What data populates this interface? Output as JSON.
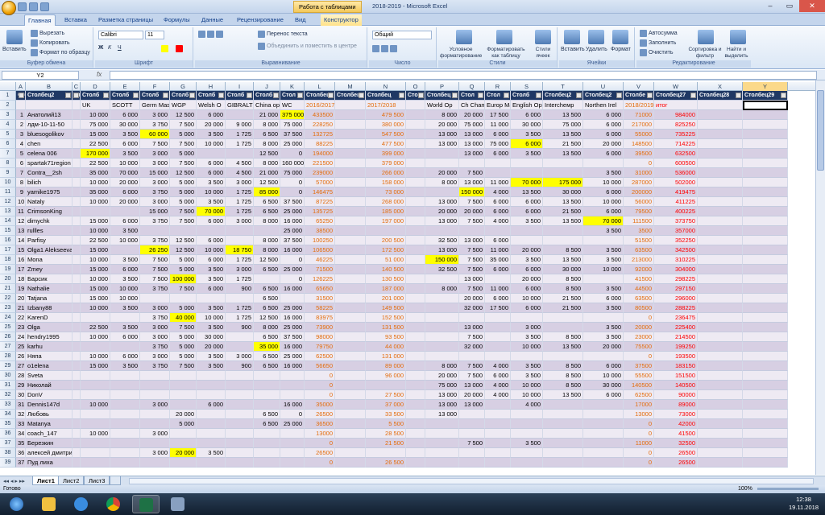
{
  "window": {
    "title": "2018-2019 - Microsoft Excel",
    "context_tab_title": "Работа с таблицами",
    "controls": [
      "–",
      "▭",
      "✕"
    ]
  },
  "ribbon_tabs": [
    "Главная",
    "Вставка",
    "Разметка страницы",
    "Формулы",
    "Данные",
    "Рецензирование",
    "Вид",
    "Конструктор"
  ],
  "ribbon": {
    "clipboard": {
      "group": "Буфер обмена",
      "paste": "Вставить",
      "cut": "Вырезать",
      "copy": "Копировать",
      "format_painter": "Формат по образцу"
    },
    "font": {
      "group": "Шрифт",
      "name": "Calibri",
      "size": "11"
    },
    "alignment": {
      "group": "Выравнивание",
      "wrap": "Перенос текста",
      "merge": "Объединить и поместить в центре"
    },
    "number": {
      "group": "Число",
      "format": "Общий"
    },
    "styles": {
      "group": "Стили",
      "conditional": "Условное форматирование",
      "as_table": "Форматировать как таблицу",
      "cell_styles": "Стили ячеек"
    },
    "cells": {
      "group": "Ячейки",
      "insert": "Вставить",
      "delete": "Удалить",
      "format": "Формат"
    },
    "editing": {
      "group": "Редактирование",
      "autosum": "Автосумма",
      "fill": "Заполнить",
      "clear": "Очистить",
      "sort": "Сортировка и фильтр",
      "find": "Найти и выделить"
    }
  },
  "formula_bar": {
    "name_box": "Y2",
    "fx": "fx",
    "value": ""
  },
  "columns": [
    "A",
    "B",
    "C",
    "D",
    "E",
    "F",
    "G",
    "H",
    "I",
    "J",
    "K",
    "L",
    "M",
    "N",
    "O",
    "P",
    "Q",
    "R",
    "S",
    "T",
    "U",
    "V",
    "W",
    "X",
    "Y"
  ],
  "header_row": [
    "Столб",
    "Столбец2",
    "Сто",
    "Столб",
    "Столб",
    "Столб",
    "Столб",
    "Столб",
    "Столб",
    "Столб",
    "Стол",
    "Столбец",
    "Столбец",
    "Столбец",
    "Сто",
    "Столбец",
    "Стол",
    "Стол",
    "Столб",
    "Столбец2",
    "Столбец2",
    "Столбе",
    "Столбец27",
    "Столбец28",
    "Столбец29"
  ],
  "row2": [
    "",
    "",
    "",
    "UK",
    "SCOTT",
    "Germ Mas",
    "WGP",
    "Welsh O",
    "GIBRALT",
    "China op",
    "WC",
    "2016/2017",
    "",
    "2017/2018",
    "",
    "World Op",
    "Ch Cham",
    "Europ Ma",
    "English Op",
    "Intercheмp",
    "Northen Irel",
    "2018/2019",
    "итог",
    "",
    ""
  ],
  "rows": [
    [
      "1",
      "Анатолий13",
      "",
      "10 000",
      "6 000",
      "3 000",
      "12 500",
      "6 000",
      "",
      "21 000",
      "375 000",
      "433500",
      "",
      "479 500",
      "",
      "8 000",
      "20 000",
      "17 500",
      "6 000",
      "13 500",
      "6 000",
      "71000",
      "984000",
      "",
      ""
    ],
    [
      "2",
      "лдм-10-11-50",
      "",
      "75 000",
      "30 000",
      "3 750",
      "7 500",
      "20 000",
      "9 000",
      "8 000",
      "75 000",
      "228250",
      "",
      "380 000",
      "",
      "20 000",
      "75 000",
      "11 000",
      "30 000",
      "75 000",
      "6 000",
      "217000",
      "825250",
      "",
      ""
    ],
    [
      "3",
      "bluesogolikov",
      "",
      "15 000",
      "3 500",
      "60 000",
      "5 000",
      "3 500",
      "1 725",
      "6 500",
      "37 500",
      "132725",
      "",
      "547 500",
      "",
      "13 000",
      "13 000",
      "6 000",
      "3 500",
      "13 500",
      "6 000",
      "55000",
      "735225",
      "",
      ""
    ],
    [
      "4",
      "chen",
      "",
      "22 500",
      "6 000",
      "7 500",
      "7 500",
      "10 000",
      "1 725",
      "8 000",
      "25 000",
      "88225",
      "",
      "477 500",
      "",
      "13 000",
      "13 000",
      "75 000",
      "6 000",
      "21 500",
      "20 000",
      "148500",
      "714225",
      "",
      ""
    ],
    [
      "5",
      "celena 006",
      "",
      "170 000",
      "3 500",
      "3 000",
      "5 000",
      "",
      "",
      "12 500",
      "0",
      "194000",
      "",
      "399 000",
      "",
      "",
      "13 000",
      "6 000",
      "3 500",
      "13 500",
      "6 000",
      "39500",
      "632500",
      "",
      ""
    ],
    [
      "6",
      "spartak71region",
      "",
      "22 500",
      "10 000",
      "3 000",
      "7 500",
      "6 000",
      "4 500",
      "8 000",
      "160 000",
      "221500",
      "",
      "379 000",
      "",
      "",
      "",
      "",
      "",
      "",
      "",
      "0",
      "600500",
      "",
      ""
    ],
    [
      "7",
      "Contra__2sh",
      "",
      "35 000",
      "70 000",
      "15 000",
      "12 500",
      "6 000",
      "4 500",
      "21 000",
      "75 000",
      "239000",
      "",
      "266 000",
      "",
      "20 000",
      "7 500",
      "",
      "",
      "",
      "3 500",
      "31000",
      "536000",
      "",
      ""
    ],
    [
      "8",
      "bilich",
      "",
      "10 000",
      "20 000",
      "3 000",
      "5 000",
      "3 500",
      "3 000",
      "12 500",
      "0",
      "57000",
      "",
      "158 000",
      "",
      "8 000",
      "13 000",
      "11 000",
      "70 000",
      "175 000",
      "10 000",
      "287000",
      "502000",
      "",
      ""
    ],
    [
      "9",
      "yamike1975",
      "",
      "35 000",
      "6 000",
      "3 750",
      "5 000",
      "10 000",
      "1 725",
      "85 000",
      "0",
      "146475",
      "",
      "73 000",
      "",
      "",
      "150 000",
      "4 000",
      "13 500",
      "30 000",
      "6 000",
      "200000",
      "419475",
      "",
      ""
    ],
    [
      "10",
      "Nataly",
      "",
      "10 000",
      "20 000",
      "3 000",
      "5 000",
      "3 500",
      "1 725",
      "6 500",
      "37 500",
      "87225",
      "",
      "268 000",
      "",
      "13 000",
      "7 500",
      "6 000",
      "6 000",
      "13 500",
      "10 000",
      "56000",
      "411225",
      "",
      ""
    ],
    [
      "11",
      "CrimsonKing",
      "",
      "",
      "",
      "15 000",
      "7 500",
      "70 000",
      "1 725",
      "6 500",
      "25 000",
      "135725",
      "",
      "185 000",
      "",
      "20 000",
      "20 000",
      "6 000",
      "6 000",
      "21 500",
      "6 000",
      "79500",
      "400225",
      "",
      ""
    ],
    [
      "12",
      "dimychk",
      "",
      "15 000",
      "6 000",
      "3 750",
      "7 500",
      "6 000",
      "3 000",
      "8 000",
      "16 000",
      "65250",
      "",
      "197 000",
      "",
      "13 000",
      "7 500",
      "4 000",
      "3 500",
      "13 500",
      "70 000",
      "111500",
      "373750",
      "",
      ""
    ],
    [
      "13",
      "rullles",
      "",
      "10 000",
      "3 500",
      "",
      "",
      "",
      "",
      "",
      "25 000",
      "38500",
      "",
      "",
      "",
      "",
      "",
      "",
      "",
      "",
      "3 500",
      "3500",
      "357000",
      "",
      ""
    ],
    [
      "14",
      "Parfisy",
      "",
      "22 500",
      "10 000",
      "3 750",
      "12 500",
      "6 000",
      "",
      "8 000",
      "37 500",
      "100250",
      "",
      "200 500",
      "",
      "32 500",
      "13 000",
      "6 000",
      "",
      "",
      "",
      "51500",
      "352250",
      "",
      ""
    ],
    [
      "15",
      "Olga1 Alekseeva",
      "",
      "15 000",
      "",
      "26 250",
      "12 500",
      "10 000",
      "18 750",
      "8 000",
      "16 000",
      "106500",
      "",
      "172 500",
      "",
      "13 000",
      "7 500",
      "11 000",
      "20 000",
      "8 500",
      "3 500",
      "63500",
      "342500",
      "",
      ""
    ],
    [
      "16",
      "Mona",
      "",
      "10 000",
      "3 500",
      "7 500",
      "5 000",
      "6 000",
      "1 725",
      "12 500",
      "0",
      "46225",
      "",
      "51 000",
      "",
      "150 000",
      "7 500",
      "35 000",
      "3 500",
      "13 500",
      "3 500",
      "213000",
      "310225",
      "",
      ""
    ],
    [
      "17",
      "Zmey",
      "",
      "15 000",
      "6 000",
      "7 500",
      "5 000",
      "3 500",
      "3 000",
      "6 500",
      "25 000",
      "71500",
      "",
      "140 500",
      "",
      "32 500",
      "7 500",
      "6 000",
      "6 000",
      "30 000",
      "10 000",
      "92000",
      "304000",
      "",
      ""
    ],
    [
      "18",
      "Барсик",
      "",
      "10 000",
      "3 500",
      "7 500",
      "100 000",
      "3 500",
      "1 725",
      "",
      "0",
      "126225",
      "",
      "130 500",
      "",
      "",
      "13 000",
      "",
      "20 000",
      "8 500",
      "",
      "41500",
      "298225",
      "",
      ""
    ],
    [
      "19",
      "Nathalie",
      "",
      "15 000",
      "10 000",
      "3 750",
      "7 500",
      "6 000",
      "900",
      "6 500",
      "16 000",
      "65650",
      "",
      "187 000",
      "",
      "8 000",
      "7 500",
      "11 000",
      "6 000",
      "8 500",
      "3 500",
      "44500",
      "297150",
      "",
      ""
    ],
    [
      "20",
      "Tatjana",
      "",
      "15 000",
      "10 000",
      "",
      "",
      "",
      "",
      "6 500",
      "",
      "31500",
      "",
      "201 000",
      "",
      "",
      "20 000",
      "6 000",
      "10 000",
      "21 500",
      "6 000",
      "63500",
      "296000",
      "",
      ""
    ],
    [
      "21",
      "Izbany88",
      "",
      "10 000",
      "3 500",
      "3 000",
      "5 000",
      "3 500",
      "1 725",
      "6 500",
      "25 000",
      "58225",
      "",
      "149 500",
      "",
      "",
      "32 000",
      "17 500",
      "6 000",
      "21 500",
      "3 500",
      "80500",
      "288225",
      "",
      ""
    ],
    [
      "22",
      "KarenD",
      "",
      "",
      "",
      "3 750",
      "40 000",
      "10 000",
      "1 725",
      "12 500",
      "16 000",
      "83975",
      "",
      "152 500",
      "",
      "",
      "",
      "",
      "",
      "",
      "",
      "0",
      "236475",
      "",
      ""
    ],
    [
      "23",
      "Olga",
      "",
      "22 500",
      "3 500",
      "3 000",
      "7 500",
      "3 500",
      "900",
      "8 000",
      "25 000",
      "73900",
      "",
      "131 500",
      "",
      "",
      "13 000",
      "",
      "3 000",
      "",
      "3 500",
      "20000",
      "225400",
      "",
      ""
    ],
    [
      "24",
      "hendry1995",
      "",
      "10 000",
      "6 000",
      "3 000",
      "5 000",
      "30 000",
      "",
      "6 500",
      "37 500",
      "98000",
      "",
      "93 500",
      "",
      "",
      "7 500",
      "",
      "3 500",
      "8 500",
      "3 500",
      "23000",
      "214500",
      "",
      ""
    ],
    [
      "25",
      "karhu",
      "",
      "",
      "",
      "3 750",
      "5 000",
      "20 000",
      "",
      "35 000",
      "16 000",
      "79750",
      "",
      "44 000",
      "",
      "",
      "32 000",
      "",
      "10 000",
      "13 500",
      "20 000",
      "75500",
      "199250",
      "",
      ""
    ],
    [
      "26",
      "Няпа",
      "",
      "10 000",
      "6 000",
      "3 000",
      "5 000",
      "3 500",
      "3 000",
      "6 500",
      "25 000",
      "62500",
      "",
      "131 000",
      "",
      "",
      "",
      "",
      "",
      "",
      "",
      "0",
      "193500",
      "",
      ""
    ],
    [
      "27",
      "o1elena",
      "",
      "15 000",
      "3 500",
      "3 750",
      "7 500",
      "3 500",
      "900",
      "6 500",
      "16 000",
      "56650",
      "",
      "89 000",
      "",
      "8 000",
      "7 500",
      "4 000",
      "3 500",
      "8 500",
      "6 000",
      "37500",
      "183150",
      "",
      ""
    ],
    [
      "28",
      "Sveta",
      "",
      "",
      "",
      "",
      "",
      "",
      "",
      "",
      "",
      "0",
      "",
      "96 000",
      "",
      "20 000",
      "7 500",
      "6 000",
      "3 500",
      "8 500",
      "10 000",
      "55500",
      "151500",
      "",
      ""
    ],
    [
      "29",
      "Николай",
      "",
      "",
      "",
      "",
      "",
      "",
      "",
      "",
      "",
      "0",
      "",
      "",
      "",
      "75 000",
      "13 000",
      "4 000",
      "10 000",
      "8 500",
      "30 000",
      "140500",
      "140500",
      "",
      ""
    ],
    [
      "30",
      "DonV",
      "",
      "",
      "",
      "",
      "",
      "",
      "",
      "",
      "",
      "0",
      "",
      "27 500",
      "",
      "13 000",
      "20 000",
      "4 000",
      "10 000",
      "13 500",
      "6 000",
      "62500",
      "90000",
      "",
      ""
    ],
    [
      "31",
      "Dennis147d",
      "",
      "10 000",
      "",
      "3 000",
      "",
      "6 000",
      "",
      "",
      "16 000",
      "35000",
      "",
      "37 000",
      "",
      "13 000",
      "13 000",
      "",
      "4 000",
      "",
      "",
      "17000",
      "89000",
      "",
      ""
    ],
    [
      "32",
      "Любовь",
      "",
      "",
      "",
      "",
      "20 000",
      "",
      "",
      "6 500",
      "0",
      "26500",
      "",
      "33 500",
      "",
      "13 000",
      "",
      "",
      "",
      "",
      "",
      "13000",
      "73000",
      "",
      ""
    ],
    [
      "33",
      "Matanya",
      "",
      "",
      "",
      "",
      "5 000",
      "",
      "",
      "6 500",
      "25 000",
      "36500",
      "",
      "5 500",
      "",
      "",
      "",
      "",
      "",
      "",
      "",
      "0",
      "42000",
      "",
      ""
    ],
    [
      "34",
      "coach_147",
      "",
      "10 000",
      "",
      "3 000",
      "",
      "",
      "",
      "",
      "",
      "13000",
      "",
      "28 500",
      "",
      "",
      "",
      "",
      "",
      "",
      "",
      "0",
      "41500",
      "",
      ""
    ],
    [
      "35",
      "Березкин",
      "",
      "",
      "",
      "",
      "",
      "",
      "",
      "",
      "",
      "0",
      "",
      "21 500",
      "",
      "",
      "7 500",
      "",
      "3 500",
      "",
      "",
      "11000",
      "32500",
      "",
      ""
    ],
    [
      "36",
      "алексей дмитриевич",
      "",
      "",
      "",
      "3 000",
      "20 000",
      "3 500",
      "",
      "",
      "",
      "26500",
      "",
      "",
      "",
      "",
      "",
      "",
      "",
      "",
      "",
      "0",
      "26500",
      "",
      ""
    ],
    [
      "37",
      "Пуд лиха",
      "",
      "",
      "",
      "",
      "",
      "",
      "",
      "",
      "",
      "0",
      "",
      "26 500",
      "",
      "",
      "",
      "",
      "",
      "",
      "",
      "0",
      "26500",
      "",
      ""
    ]
  ],
  "sheets": [
    "Лист1",
    "Лист2",
    "Лист3"
  ],
  "status": {
    "ready": "Готово",
    "zoom": "100%"
  },
  "clock": {
    "time": "12:38",
    "date": "19.11.2018"
  },
  "accent_colors": {
    "header_bg": "#1f3864",
    "row_dark": "#d7cfe3",
    "row_light": "#eeeaf3",
    "highlight": "#ffff00",
    "orange": "#e46c0a",
    "red": "#ff0000"
  }
}
